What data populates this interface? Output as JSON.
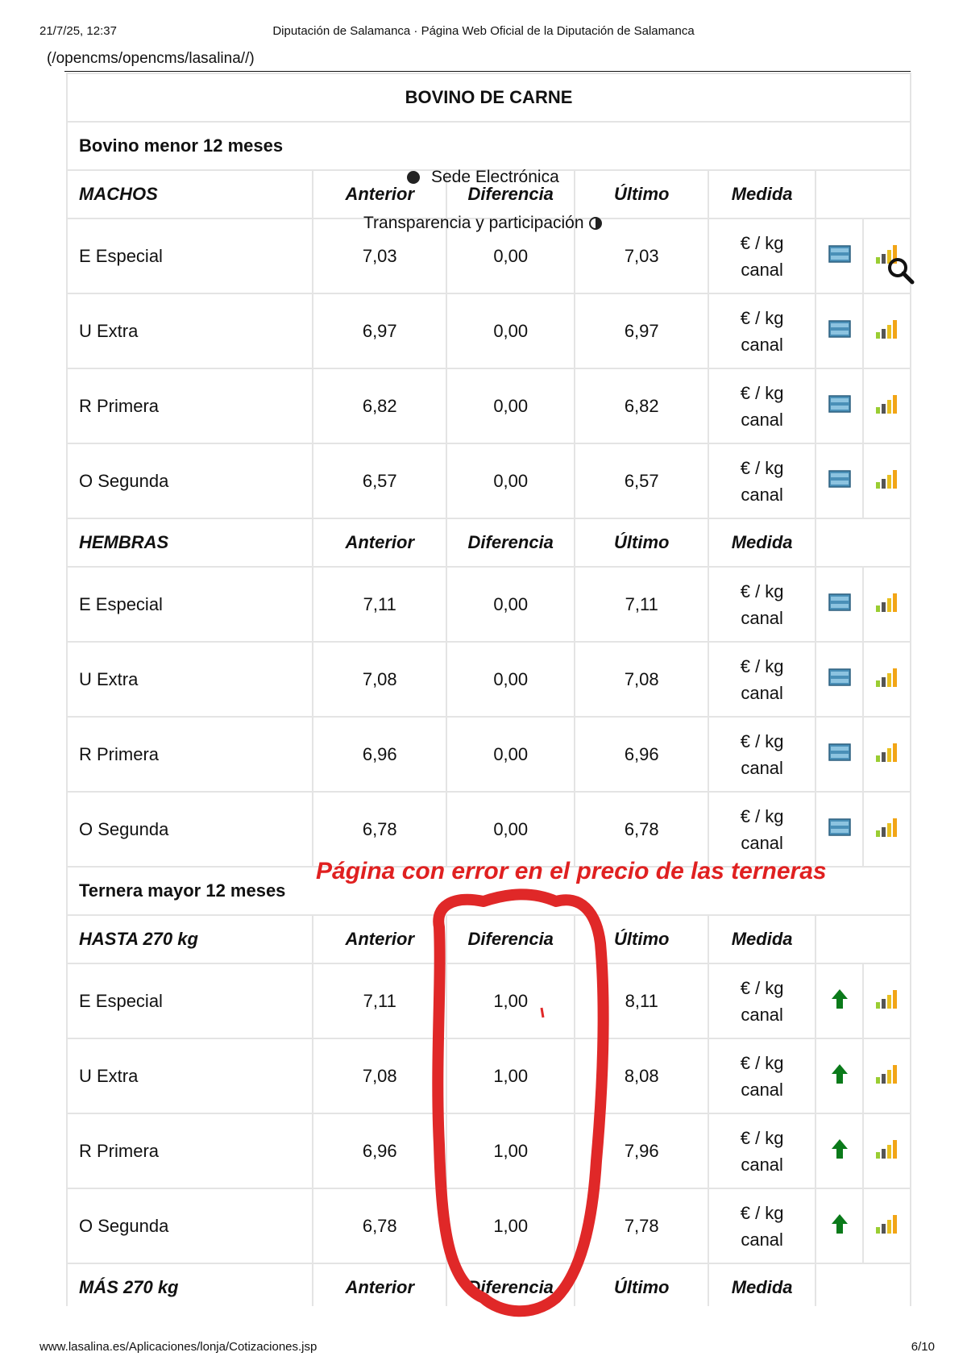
{
  "print_header": {
    "datetime": "21/7/25, 12:37",
    "title": "Diputación de Salamanca · Página Web Oficial de la Diputación de Salamanca"
  },
  "path_link": "(/opencms/opencms/lasalina//)",
  "overlays": {
    "sede": "Sede Electrónica",
    "transparencia": "Transparencia y participación"
  },
  "table": {
    "title": "BOVINO DE CARNE",
    "sections": [
      {
        "subtitle": "Bovino menor 12 meses",
        "groups": [
          {
            "header": [
              "MACHOS",
              "Anterior",
              "Diferencia",
              "Último",
              "Medida"
            ],
            "trend_icon": "table-icon",
            "rows": [
              {
                "name": "E Especial",
                "anterior": "7,03",
                "diferencia": "0,00",
                "ultimo": "7,03",
                "medida": [
                  "€ / kg",
                  "canal"
                ]
              },
              {
                "name": "U Extra",
                "anterior": "6,97",
                "diferencia": "0,00",
                "ultimo": "6,97",
                "medida": [
                  "€ / kg",
                  "canal"
                ]
              },
              {
                "name": "R Primera",
                "anterior": "6,82",
                "diferencia": "0,00",
                "ultimo": "6,82",
                "medida": [
                  "€ / kg",
                  "canal"
                ]
              },
              {
                "name": "O Segunda",
                "anterior": "6,57",
                "diferencia": "0,00",
                "ultimo": "6,57",
                "medida": [
                  "€ / kg",
                  "canal"
                ]
              }
            ]
          },
          {
            "header": [
              "HEMBRAS",
              "Anterior",
              "Diferencia",
              "Último",
              "Medida"
            ],
            "trend_icon": "table-icon",
            "rows": [
              {
                "name": "E Especial",
                "anterior": "7,11",
                "diferencia": "0,00",
                "ultimo": "7,11",
                "medida": [
                  "€ / kg",
                  "canal"
                ]
              },
              {
                "name": "U Extra",
                "anterior": "7,08",
                "diferencia": "0,00",
                "ultimo": "7,08",
                "medida": [
                  "€ / kg",
                  "canal"
                ]
              },
              {
                "name": "R Primera",
                "anterior": "6,96",
                "diferencia": "0,00",
                "ultimo": "6,96",
                "medida": [
                  "€ / kg",
                  "canal"
                ]
              },
              {
                "name": "O Segunda",
                "anterior": "6,78",
                "diferencia": "0,00",
                "ultimo": "6,78",
                "medida": [
                  "€ / kg",
                  "canal"
                ]
              }
            ]
          }
        ]
      },
      {
        "subtitle": "Ternera mayor 12 meses",
        "groups": [
          {
            "header": [
              "HASTA 270 kg",
              "Anterior",
              "Diferencia",
              "Último",
              "Medida"
            ],
            "trend_icon": "up-arrow-icon",
            "rows": [
              {
                "name": "E Especial",
                "anterior": "7,11",
                "diferencia": "1,00",
                "ultimo": "8,11",
                "medida": [
                  "€ / kg",
                  "canal"
                ]
              },
              {
                "name": "U Extra",
                "anterior": "7,08",
                "diferencia": "1,00",
                "ultimo": "8,08",
                "medida": [
                  "€ / kg",
                  "canal"
                ]
              },
              {
                "name": "R Primera",
                "anterior": "6,96",
                "diferencia": "1,00",
                "ultimo": "7,96",
                "medida": [
                  "€ / kg",
                  "canal"
                ]
              },
              {
                "name": "O Segunda",
                "anterior": "6,78",
                "diferencia": "1,00",
                "ultimo": "7,78",
                "medida": [
                  "€ / kg",
                  "canal"
                ]
              }
            ]
          },
          {
            "header": [
              "MÁS 270 kg",
              "Anterior",
              "Diferencia",
              "Último",
              "Medida"
            ],
            "trend_icon": "up-arrow-icon",
            "rows": []
          }
        ]
      }
    ]
  },
  "annotation": "Página con error en el precio de las terneras",
  "print_footer": {
    "url": "www.lasalina.es/Aplicaciones/lonja/Cotizaciones.jsp",
    "page": "6/10"
  },
  "colors": {
    "annotation_red": "#e02020",
    "grid": "#e4e4e4",
    "arrow_green": "#0a7a1a"
  }
}
